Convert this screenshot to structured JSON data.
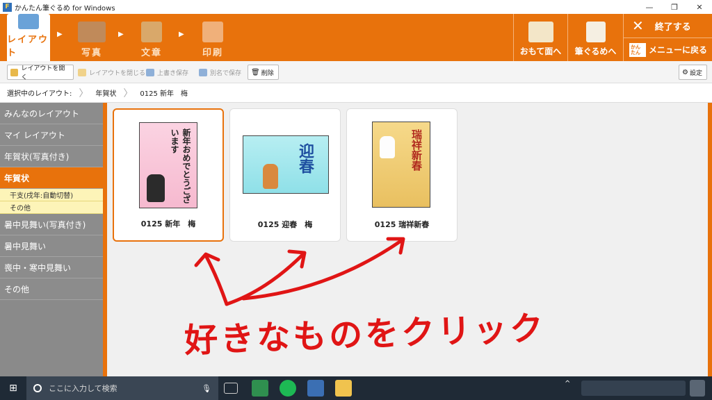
{
  "window": {
    "title": "かんたん筆ぐるめ for Windows"
  },
  "ribbon": {
    "tabs": [
      {
        "label": "レイアウト",
        "active": true
      },
      {
        "label": "写真",
        "active": false
      },
      {
        "label": "文章",
        "active": false
      },
      {
        "label": "印刷",
        "active": false
      }
    ],
    "omote_label": "おもて面へ",
    "fudegurume_label": "筆ぐるめへ",
    "close_label": "終了する",
    "menu_badge": "かんたん",
    "menu_label": "メニューに戻る"
  },
  "toolbar": {
    "open": "レイアウトを開く",
    "close": "レイアウトを閉じる",
    "overwrite": "上書き保存",
    "saveas": "別名で保存",
    "delete": "削除",
    "settings": "設定"
  },
  "breadcrumb": {
    "label": "選択中のレイアウト:",
    "level1": "年賀状",
    "level2": "0125 新年　梅"
  },
  "sidebar": {
    "items": [
      {
        "label": "みんなのレイアウト"
      },
      {
        "label": "マイ レイアウト"
      },
      {
        "label": "年賀状(写真付き)"
      },
      {
        "label": "年賀状",
        "active": true
      },
      {
        "label": "暑中見舞い(写真付き)"
      },
      {
        "label": "暑中見舞い"
      },
      {
        "label": "喪中・寒中見舞い"
      },
      {
        "label": "その他"
      }
    ],
    "subitems": [
      {
        "label": "干支(戌年:自動切替)"
      },
      {
        "label": "その他"
      }
    ]
  },
  "cards": [
    {
      "title": "0125 新年　梅",
      "text": "新年おめでとうございます"
    },
    {
      "title": "0125 迎春　梅",
      "text": "迎春"
    },
    {
      "title": "0125 瑞祥新春",
      "text": "瑞祥新春"
    }
  ],
  "annotation": {
    "text": "好きなものをクリック",
    "color": "#e01515"
  },
  "taskbar": {
    "search_placeholder": "ここに入力して検索"
  },
  "colors": {
    "accent": "#e8720c",
    "sidebar": "#8a8a8a",
    "annotation": "#e01515"
  }
}
